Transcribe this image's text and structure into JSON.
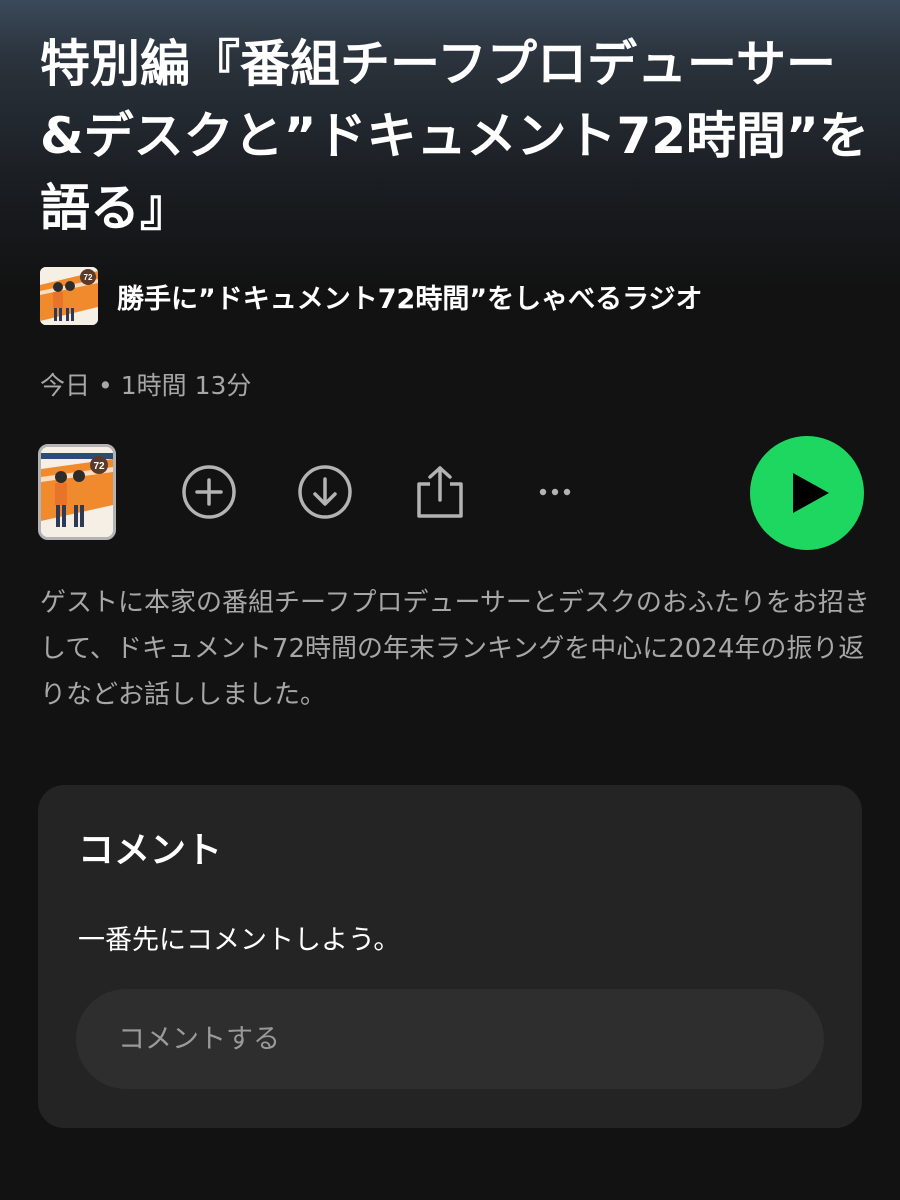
{
  "episode": {
    "title": "特別編『番組チーフプロデューサー&デスクと”ドキュメント72時間”を語る』",
    "show_name": "勝手に”ドキュメント72時間”をしゃべるラジオ",
    "date": "今日",
    "separator": "•",
    "duration": "1時間 13分",
    "art_badge": "72",
    "description": "ゲストに本家の番組チーフプロデューサーとデスクのおふたりをお招きして、ドキュメント72時間の年末ランキングを中心に2024年の振り返りなどお話ししました。"
  },
  "actions": {
    "icons": [
      "plus-circle-icon",
      "download-icon",
      "share-icon",
      "more-icon",
      "play-icon"
    ],
    "play_color": "#1ed760"
  },
  "comments": {
    "title": "コメント",
    "empty_text": "一番先にコメントしよう。",
    "input_placeholder": "コメントする"
  }
}
